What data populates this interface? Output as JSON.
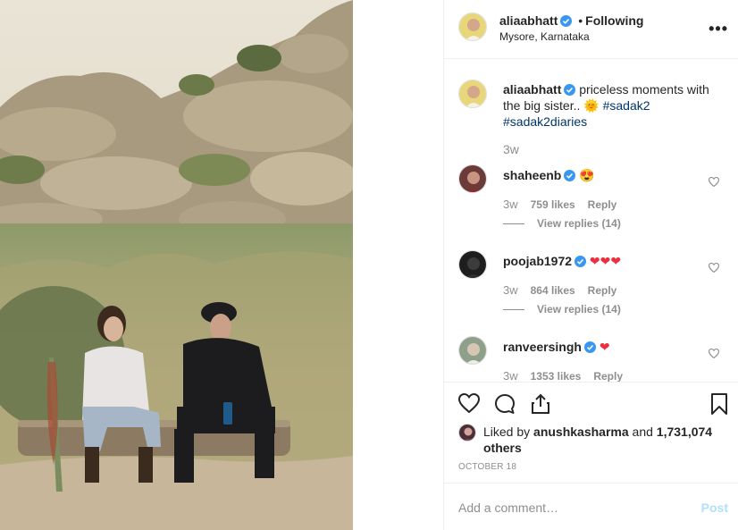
{
  "post": {
    "username": "aliaabhatt",
    "follow_status": "Following",
    "separator": "•",
    "location": "Mysore, Karnataka",
    "more_label": "•••",
    "photo_alt": "Two women sitting on a log among tall grass and rocky hills"
  },
  "caption": {
    "username": "aliaabhatt",
    "text": "priceless moments with the big sister..",
    "emoji": "🌞",
    "hashtags": [
      "#sadak2",
      "#sadak2diaries"
    ],
    "time": "3w"
  },
  "comments": [
    {
      "username": "shaheenb",
      "verified": true,
      "text": "😍",
      "time": "3w",
      "likes": "759 likes",
      "reply_label": "Reply",
      "view_replies": "View replies (14)"
    },
    {
      "username": "poojab1972",
      "verified": true,
      "text": "❤❤❤",
      "time": "3w",
      "likes": "864 likes",
      "reply_label": "Reply",
      "view_replies": "View replies (14)"
    },
    {
      "username": "ranveersingh",
      "verified": true,
      "text": "❤",
      "time": "3w",
      "likes": "1353 likes",
      "reply_label": "Reply"
    }
  ],
  "liked_by": {
    "prefix": "Liked by",
    "user": "anushkasharma",
    "connector": "and",
    "others": "1,731,074 others"
  },
  "date": "OCTOBER 18",
  "add_comment": {
    "placeholder": "Add a comment…",
    "post_label": "Post"
  },
  "icons": {
    "like": "heart-outline-icon",
    "comment": "comment-bubble-icon",
    "share": "share-icon",
    "save": "bookmark-icon",
    "verified": "verified-badge-icon"
  },
  "colors": {
    "verified": "#3897f0",
    "hashtag": "#003569",
    "muted": "#8e8e8e",
    "post_disabled": "#b2dffc",
    "heart_red": "#ed4956"
  }
}
